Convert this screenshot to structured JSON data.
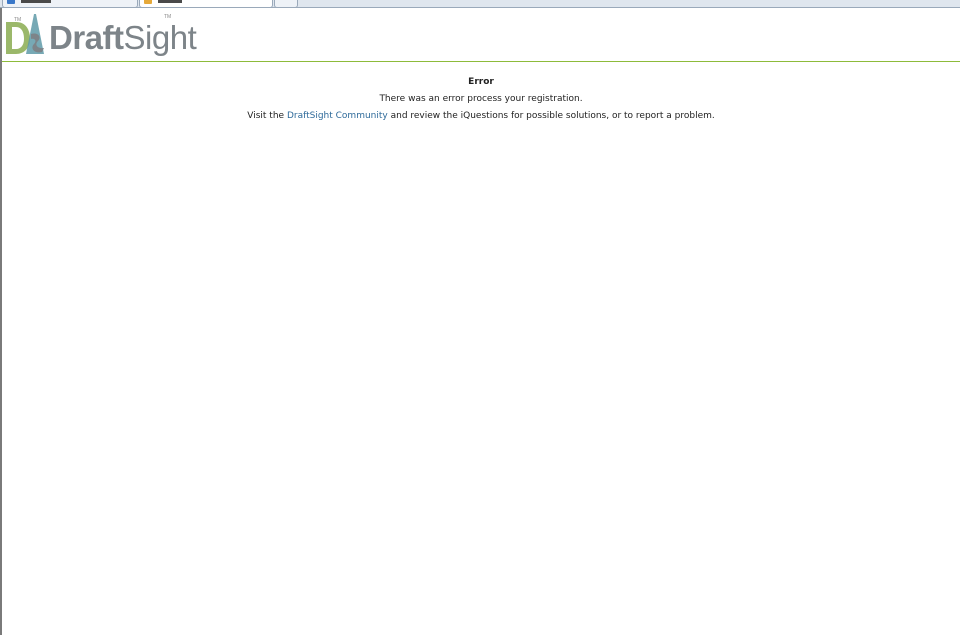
{
  "logo": {
    "brand_bold": "Draft",
    "brand_light": "Sight",
    "trademark": "TM"
  },
  "error": {
    "title": "Error",
    "message": "There was an error process your registration.",
    "help_prefix": "Visit the ",
    "help_link": "DraftSight Community",
    "help_suffix": " and review the iQuestions for possible solutions, or to report a problem."
  },
  "colors": {
    "accent_rule": "#8dbb3a",
    "link": "#2e6a9a",
    "logo_gray": "#7d8489",
    "logo_teal": "#5f9aa8"
  }
}
